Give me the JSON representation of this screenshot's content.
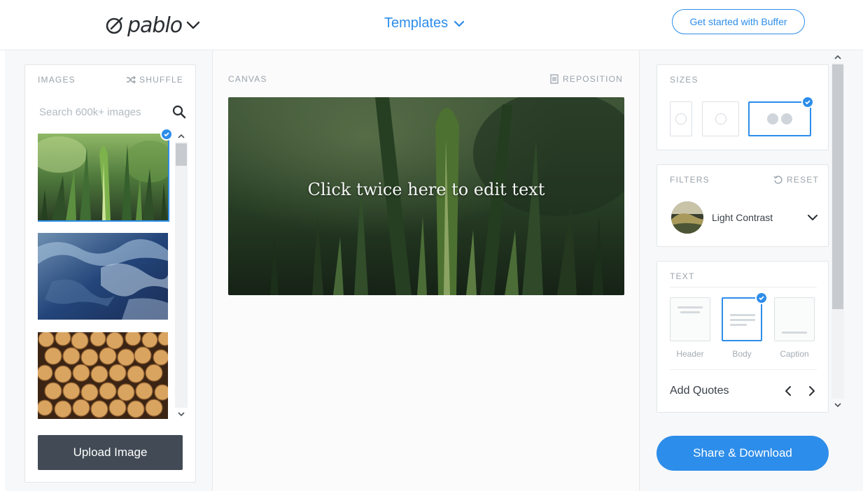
{
  "header": {
    "logo_text": "pablo",
    "templates_label": "Templates",
    "cta_label": "Get started with Buffer"
  },
  "images_panel": {
    "title": "IMAGES",
    "shuffle_label": "SHUFFLE",
    "search_placeholder": "Search 600k+ images",
    "thumbnails": [
      {
        "subject": "green leek leaves",
        "selected": true
      },
      {
        "subject": "blue water surface",
        "selected": false
      },
      {
        "subject": "stacked wood logs",
        "selected": false
      }
    ],
    "upload_label": "Upload Image"
  },
  "canvas": {
    "title": "CANVAS",
    "reposition_label": "REPOSITION",
    "overlay_text": "Click twice here to edit text"
  },
  "sizes": {
    "title": "SIZES",
    "options": [
      {
        "icon": "pinterest-icon",
        "selected": false
      },
      {
        "icon": "instagram-icon",
        "selected": false
      },
      {
        "icon": "facebook-twitter-icon",
        "selected": true
      }
    ]
  },
  "filters": {
    "title": "FILTERS",
    "reset_label": "RESET",
    "current": "Light Contrast"
  },
  "text_panel": {
    "title": "TEXT",
    "styles": [
      {
        "label": "Header",
        "selected": false
      },
      {
        "label": "Body",
        "selected": true
      },
      {
        "label": "Caption",
        "selected": false
      }
    ],
    "quotes_label": "Add Quotes"
  },
  "share_label": "Share & Download",
  "colors": {
    "accent": "#2d8dea",
    "dark_button": "#424b55",
    "muted_text": "#9aa3ab"
  }
}
